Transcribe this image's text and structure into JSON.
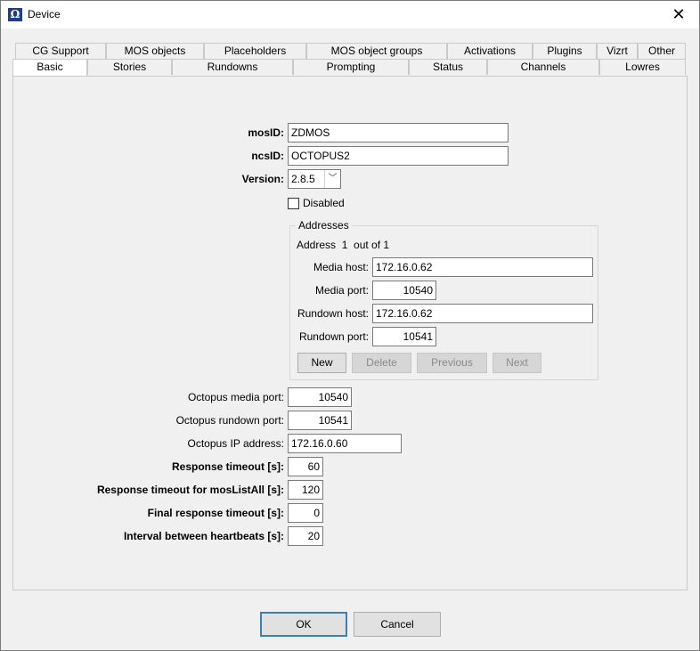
{
  "window": {
    "title": "Device",
    "app_icon_glyph": "Ω"
  },
  "tabs_row1": [
    "CG Support",
    "MOS objects",
    "Placeholders",
    "MOS object groups",
    "Activations",
    "Plugins",
    "Vizrt",
    "Other"
  ],
  "tabs_row2": [
    "Basic",
    "Stories",
    "Rundowns",
    "Prompting",
    "Status",
    "Channels",
    "Lowres"
  ],
  "active_tab": "Basic",
  "basic": {
    "mosid_label": "mosID:",
    "mosid_value": "ZDMOS",
    "ncsid_label": "ncsID:",
    "ncsid_value": "OCTOPUS2",
    "version_label": "Version:",
    "version_value": "2.8.5",
    "disabled_label": "Disabled",
    "disabled_checked": false
  },
  "addresses": {
    "group_title": "Addresses",
    "counter": "Address  1  out of 1",
    "media_host_label": "Media host:",
    "media_host_value": "172.16.0.62",
    "media_port_label": "Media port:",
    "media_port_value": "10540",
    "rundown_host_label": "Rundown host:",
    "rundown_host_value": "172.16.0.62",
    "rundown_port_label": "Rundown port:",
    "rundown_port_value": "10541",
    "buttons": {
      "new": "New",
      "delete": "Delete",
      "previous": "Previous",
      "next": "Next"
    }
  },
  "octopus": {
    "media_port_label": "Octopus media port:",
    "media_port_value": "10540",
    "rundown_port_label": "Octopus rundown port:",
    "rundown_port_value": "10541",
    "ip_label": "Octopus IP address:",
    "ip_value": "172.16.0.60"
  },
  "timeouts": {
    "response_label": "Response timeout [s]:",
    "response_value": "60",
    "moslistall_label": "Response timeout for mosListAll [s]:",
    "moslistall_value": "120",
    "final_label": "Final response timeout [s]:",
    "final_value": "0",
    "heartbeat_label": "Interval between heartbeats [s]:",
    "heartbeat_value": "20"
  },
  "footer": {
    "ok": "OK",
    "cancel": "Cancel"
  }
}
